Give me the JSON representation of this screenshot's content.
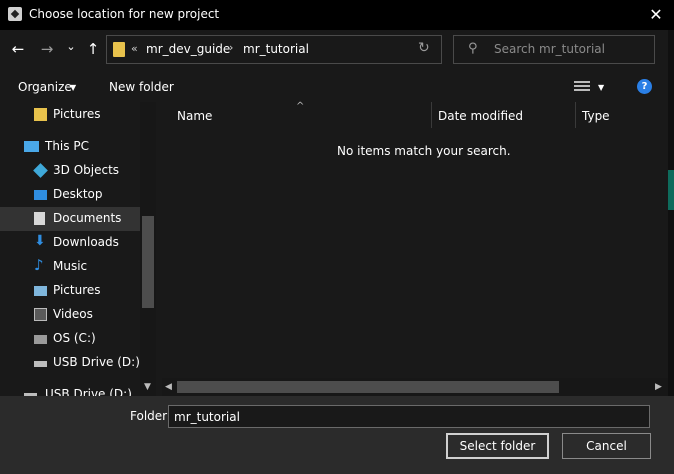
{
  "window": {
    "title": "Choose location for new project",
    "close_glyph": "✕"
  },
  "nav": {
    "back_glyph": "←",
    "forward_glyph": "→",
    "recent_glyph": "⌄",
    "up_glyph": "↑"
  },
  "address": {
    "overflow": "«",
    "crumbs": [
      "mr_dev_guide",
      "mr_tutorial"
    ],
    "sep": "›",
    "refresh_glyph": "↻"
  },
  "search": {
    "placeholder": "Search mr_tutorial",
    "icon_glyph": "⚲"
  },
  "toolbar": {
    "organize": "Organize",
    "new_folder": "New folder",
    "help": "?"
  },
  "navpane": {
    "top_item": "Pictures",
    "this_pc": "This PC",
    "items": [
      "3D Objects",
      "Desktop",
      "Documents",
      "Downloads",
      "Music",
      "Pictures",
      "Videos",
      "OS (C:)",
      "USB Drive (D:)",
      "USB Drive (D:)"
    ],
    "selected": "Documents"
  },
  "columns": {
    "name": "Name",
    "date_modified": "Date modified",
    "type": "Type"
  },
  "empty_message": "No items match your search.",
  "footer": {
    "folder_label": "Folder:",
    "folder_value": "mr_tutorial",
    "select_button": "Select folder",
    "cancel_button": "Cancel"
  }
}
